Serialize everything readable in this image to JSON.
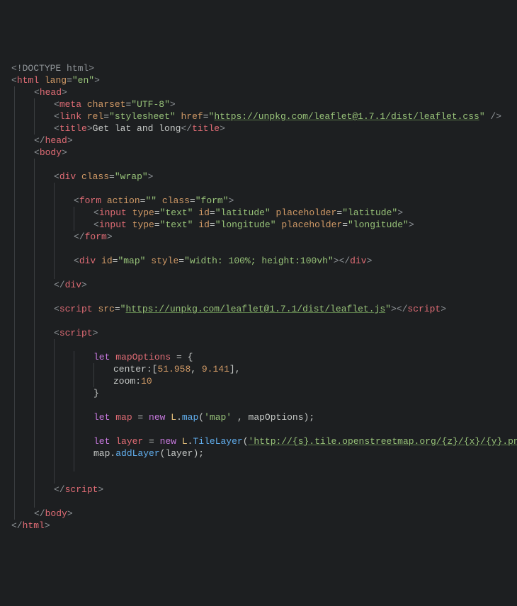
{
  "code": {
    "doctype_open": "<!",
    "doctype_word": "DOCTYPE",
    "doctype_html": " html",
    "doctype_close": ">",
    "lang_attr": "lang",
    "lang_val": "\"en\"",
    "charset_attr": "charset",
    "charset_val": "\"UTF-8\"",
    "rel_attr": "rel",
    "rel_val": "\"stylesheet\"",
    "href_attr": "href",
    "leaflet_css": "https://unpkg.com/leaflet@1.7.1/dist/leaflet.css",
    "title_text": "Get lat and long",
    "div_class_attr": "class",
    "wrap_val": "\"wrap\"",
    "form_action_attr": "action",
    "form_action_val": "\"\"",
    "form_class_val": "\"form\"",
    "input_type_attr": "type",
    "input_type_val": "\"text\"",
    "id_attr": "id",
    "lat_id_val": "\"latitude\"",
    "placeholder_attr": "placeholder",
    "lat_ph_val": "\"latitude\"",
    "lon_id_val": "\"longitude\"",
    "lon_ph_val": "\"longitude\"",
    "map_id_val": "\"map\"",
    "style_attr": "style",
    "map_style_val": "\"width: 100%; height:100vh\"",
    "src_attr": "src",
    "leaflet_js": "https://unpkg.com/leaflet@1.7.1/dist/leaflet.js",
    "let_kw": "let",
    "mapOptions": "mapOptions",
    "center_prop": "center",
    "center_vals": "[51.958, 9.141],",
    "center_open": "[",
    "center_n1": "51.958",
    "center_comma": ", ",
    "center_n2": "9.141",
    "center_close": "],",
    "zoom_prop": "zoom",
    "zoom_val": "10",
    "map_var": "map",
    "new_kw": "new",
    "L": "L",
    "map_fn": "map",
    "map_args_open": "(",
    "map_arg1": "'map'",
    "map_arg_sep": " , ",
    "map_arg2": "mapOptions",
    "map_args_close": ");",
    "layer_var": "layer",
    "TileLayer": "TileLayer",
    "tile_url": "'http://{s}.tile.openstreetmap.org/{z}/{x}/{y}.png'",
    "addLayer": "addLayer",
    "layer_ident": "layer",
    "semiclose": ");",
    "tag_html": "html",
    "tag_head": "head",
    "tag_meta": "meta",
    "tag_link": "link",
    "tag_title": "title",
    "tag_body": "body",
    "tag_div": "div",
    "tag_form": "form",
    "tag_input": "input",
    "tag_script": "script",
    "lt": "<",
    "gt": ">",
    "lts": "</",
    "sgt": " />",
    "eq": "=",
    "sp": " ",
    "q": "\"",
    "brace_open": " = {",
    "brace_close": "}",
    "colon": ":"
  }
}
